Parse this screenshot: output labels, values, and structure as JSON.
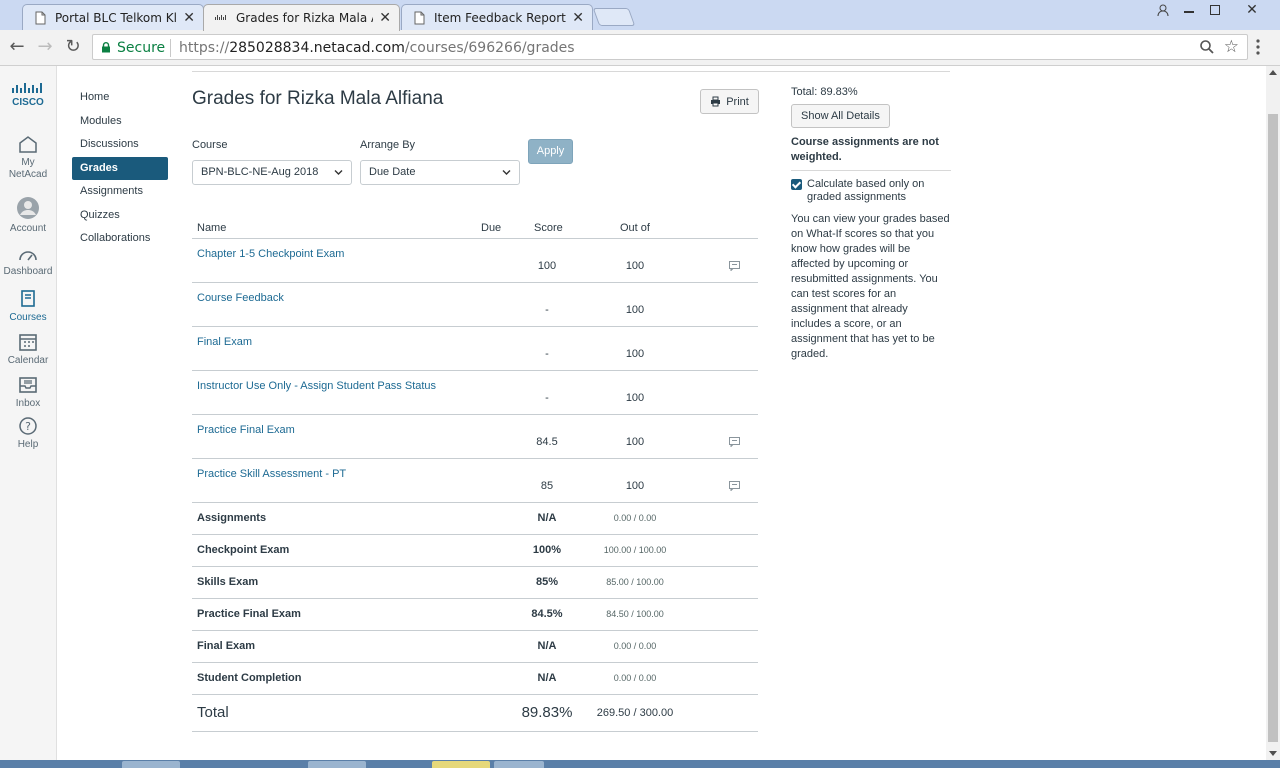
{
  "browser": {
    "tabs": [
      {
        "title": "Portal BLC Telkom Klaten",
        "active": false
      },
      {
        "title": "Grades for Rizka Mala Alfiana",
        "active": true
      },
      {
        "title": "Item Feedback Report",
        "active": false
      }
    ],
    "secure_label": "Secure",
    "url_scheme": "https://",
    "url_host": "285028834.netacad.com",
    "url_path": "/courses/696266/grades"
  },
  "global_nav": [
    {
      "label": "My NetAcad",
      "icon": "home-icon"
    },
    {
      "label": "Account",
      "icon": "account-icon"
    },
    {
      "label": "Dashboard",
      "icon": "dashboard-icon"
    },
    {
      "label": "Courses",
      "icon": "courses-icon",
      "active": true
    },
    {
      "label": "Calendar",
      "icon": "calendar-icon"
    },
    {
      "label": "Inbox",
      "icon": "inbox-icon"
    },
    {
      "label": "Help",
      "icon": "help-icon"
    }
  ],
  "course_nav": [
    {
      "label": "Home"
    },
    {
      "label": "Modules"
    },
    {
      "label": "Discussions"
    },
    {
      "label": "Grades",
      "active": true
    },
    {
      "label": "Assignments"
    },
    {
      "label": "Quizzes"
    },
    {
      "label": "Collaborations"
    }
  ],
  "page": {
    "title": "Grades for Rizka Mala Alfiana",
    "print_label": "Print",
    "course_label": "Course",
    "course_value": "BPN-BLC-NE-Aug 2018",
    "arrange_label": "Arrange By",
    "arrange_value": "Due Date",
    "apply_label": "Apply"
  },
  "table": {
    "headers": {
      "name": "Name",
      "due": "Due",
      "score": "Score",
      "outof": "Out of"
    },
    "assignments": [
      {
        "name": "Chapter 1-5 Checkpoint Exam",
        "score": "100",
        "outof": "100",
        "comment": true
      },
      {
        "name": "Course Feedback",
        "score": "-",
        "outof": "100",
        "comment": false
      },
      {
        "name": "Final Exam",
        "score": "-",
        "outof": "100",
        "comment": false
      },
      {
        "name": "Instructor Use Only - Assign Student Pass Status",
        "score": "-",
        "outof": "100",
        "comment": false
      },
      {
        "name": "Practice Final Exam",
        "score": "84.5",
        "outof": "100",
        "comment": true
      },
      {
        "name": "Practice Skill Assessment - PT",
        "score": "85",
        "outof": "100",
        "comment": true
      }
    ],
    "groups": [
      {
        "name": "Assignments",
        "score": "N/A",
        "points": "0.00 / 0.00"
      },
      {
        "name": "Checkpoint Exam",
        "score": "100%",
        "points": "100.00 / 100.00"
      },
      {
        "name": "Skills Exam",
        "score": "85%",
        "points": "85.00 / 100.00"
      },
      {
        "name": "Practice Final Exam",
        "score": "84.5%",
        "points": "84.50 / 100.00"
      },
      {
        "name": "Final Exam",
        "score": "N/A",
        "points": "0.00 / 0.00"
      },
      {
        "name": "Student Completion",
        "score": "N/A",
        "points": "0.00 / 0.00"
      }
    ],
    "total": {
      "label": "Total",
      "score": "89.83%",
      "points": "269.50 / 300.00"
    }
  },
  "sidebar": {
    "total": "Total: 89.83%",
    "show_details_label": "Show All Details",
    "weight_note": "Course assignments are not weighted.",
    "calc_label": "Calculate based only on graded assignments",
    "calc_checked": true,
    "whatif_note": "You can view your grades based on What-If scores so that you know how grades will be affected by upcoming or resubmitted assignments. You can test scores for an assignment that already includes a score, or an assignment that has yet to be graded."
  },
  "colors": {
    "accent": "#1a5a7c",
    "link": "#1d6a93",
    "apply_button": "#8fb2c6",
    "secure_green": "#0b8043"
  }
}
